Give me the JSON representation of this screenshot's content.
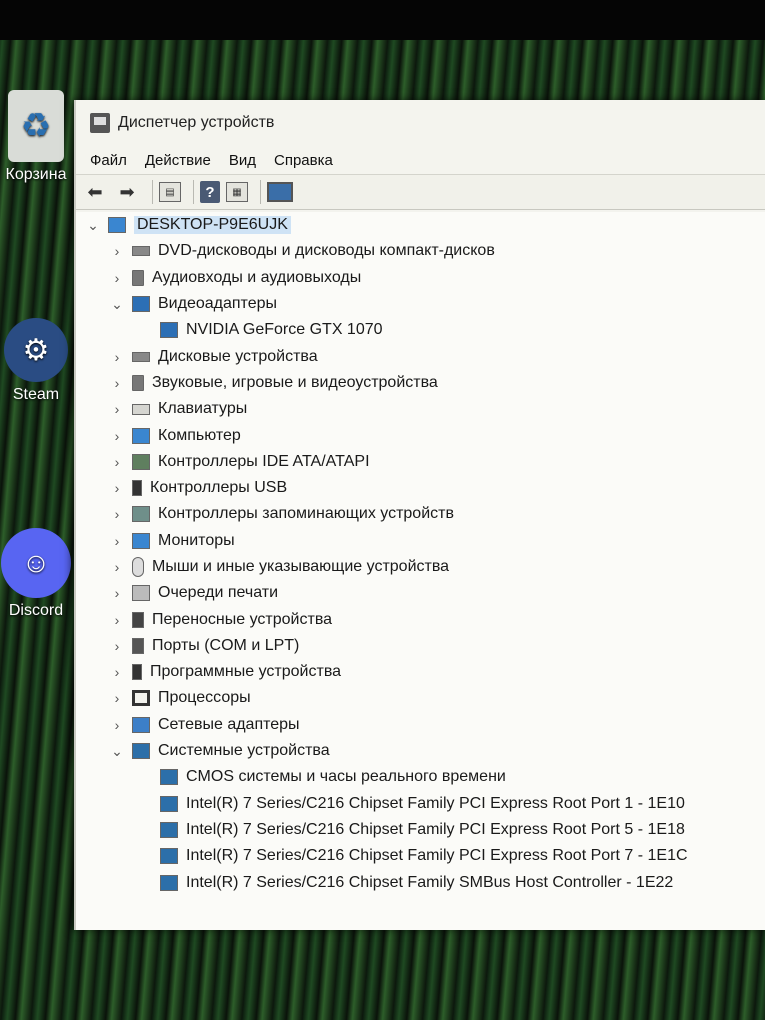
{
  "desktop": {
    "icons": [
      {
        "label": "Корзина"
      },
      {
        "label": "Steam"
      },
      {
        "label": "Discord"
      }
    ]
  },
  "window": {
    "title": "Диспетчер устройств",
    "menu": [
      "Файл",
      "Действие",
      "Вид",
      "Справка"
    ]
  },
  "tree": {
    "root": "DESKTOP-P9E6UJK",
    "categories": [
      {
        "label": "DVD-дисководы и дисководы компакт-дисков",
        "expanded": false
      },
      {
        "label": "Аудиовходы и аудиовыходы",
        "expanded": false
      },
      {
        "label": "Видеоадаптеры",
        "expanded": true
      },
      {
        "label": "NVIDIA GeForce GTX 1070",
        "child": true
      },
      {
        "label": "Дисковые устройства",
        "expanded": false
      },
      {
        "label": "Звуковые, игровые и видеоустройства",
        "expanded": false
      },
      {
        "label": "Клавиатуры",
        "expanded": false
      },
      {
        "label": "Компьютер",
        "expanded": false
      },
      {
        "label": "Контроллеры IDE ATA/ATAPI",
        "expanded": false
      },
      {
        "label": "Контроллеры USB",
        "expanded": false
      },
      {
        "label": "Контроллеры запоминающих устройств",
        "expanded": false
      },
      {
        "label": "Мониторы",
        "expanded": false
      },
      {
        "label": "Мыши и иные указывающие устройства",
        "expanded": false
      },
      {
        "label": "Очереди печати",
        "expanded": false
      },
      {
        "label": "Переносные устройства",
        "expanded": false
      },
      {
        "label": "Порты (COM и LPT)",
        "expanded": false
      },
      {
        "label": "Программные устройства",
        "expanded": false
      },
      {
        "label": "Процессоры",
        "expanded": false
      },
      {
        "label": "Сетевые адаптеры",
        "expanded": false
      },
      {
        "label": "Системные устройства",
        "expanded": true
      },
      {
        "label": "CMOS системы и часы реального времени",
        "child": true
      },
      {
        "label": "Intel(R) 7 Series/C216 Chipset Family PCI Express Root Port 1 - 1E10",
        "child": true
      },
      {
        "label": "Intel(R) 7 Series/C216 Chipset Family PCI Express Root Port 5 - 1E18",
        "child": true
      },
      {
        "label": "Intel(R) 7 Series/C216 Chipset Family PCI Express Root Port 7 - 1E1C",
        "child": true
      },
      {
        "label": "Intel(R) 7 Series/C216 Chipset Family SMBus Host Controller - 1E22",
        "child": true
      }
    ]
  }
}
